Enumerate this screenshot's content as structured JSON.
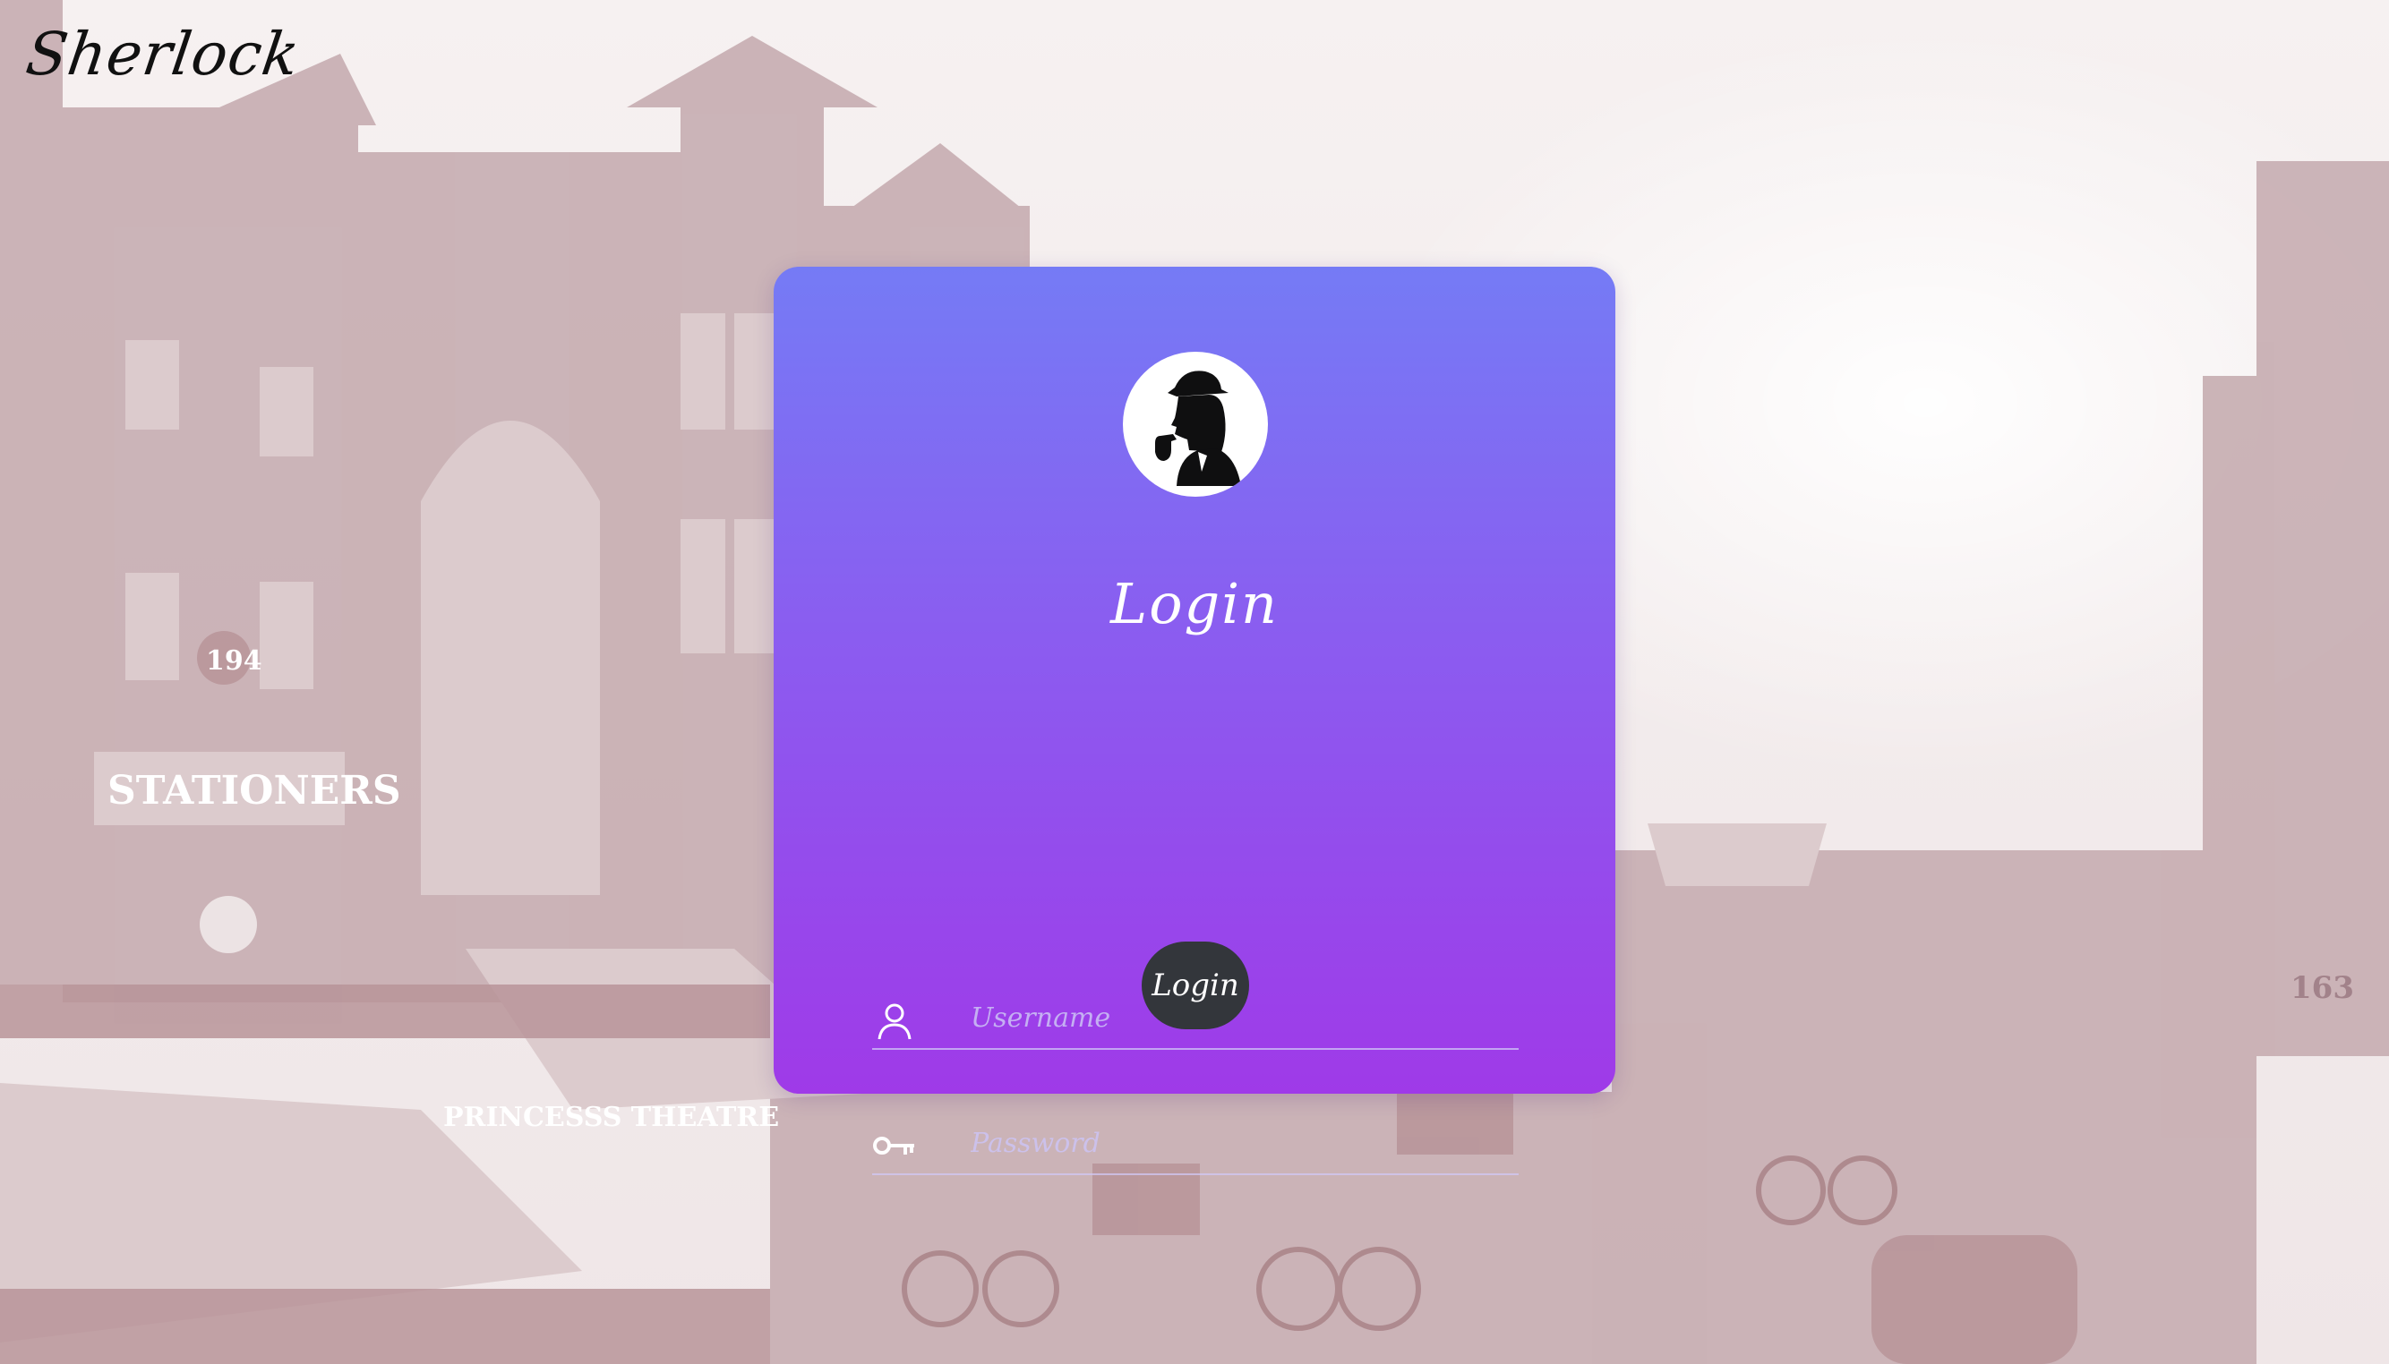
{
  "app": {
    "logo_text": "Sherlock"
  },
  "login_card": {
    "title": "Login",
    "username": {
      "placeholder": "Username",
      "value": ""
    },
    "password": {
      "placeholder": "Password",
      "value": ""
    },
    "submit_label": "Login"
  },
  "icons": {
    "avatar": "sherlock-silhouette-icon",
    "username": "user-icon",
    "password": "key-icon"
  },
  "colors": {
    "card_gradient_top": "#757bf5",
    "card_gradient_bottom": "#9f3ae8",
    "button": "#33363b",
    "background_tint": "#c9aeb2"
  }
}
